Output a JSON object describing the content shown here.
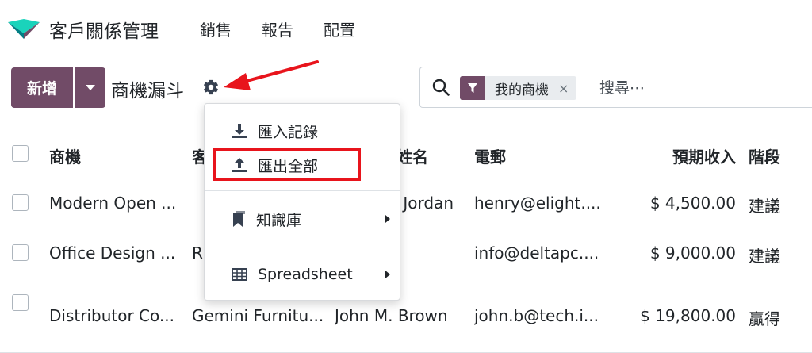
{
  "nav": {
    "app_title": "客戶關係管理",
    "items": [
      "銷售",
      "報告",
      "配置"
    ]
  },
  "control": {
    "new_label": "新增",
    "title": "商機漏斗"
  },
  "search": {
    "facet": "我的商機",
    "facet_remove": "×",
    "placeholder": "搜尋⋯"
  },
  "table": {
    "columns": [
      "商機",
      "客",
      "姓名",
      "電郵",
      "預期收入",
      "階段"
    ],
    "rows": [
      {
        "opportunity": "Modern Open ...",
        "customer": "",
        "contact": "Henry Jordan",
        "email": "henry@elight....",
        "revenue": "$ 4,500.00",
        "stage": "建議"
      },
      {
        "opportunity": "Office Design ...",
        "customer": "R",
        "contact": "",
        "email": "info@deltapc....",
        "revenue": "$ 9,000.00",
        "stage": "建議"
      },
      {
        "opportunity": "Distributor Co...",
        "customer": "Gemini Furnitu...",
        "contact": "John M. Brown",
        "email": "john.b@tech.i...",
        "revenue": "$ 19,800.00",
        "stage": "贏得"
      }
    ]
  },
  "dropdown": {
    "import": "匯入記錄",
    "export": "匯出全部",
    "knowledge": "知識庫",
    "spreadsheet": "Spreadsheet"
  },
  "colors": {
    "brand": "#714b67",
    "annotation": "#e8141c"
  }
}
